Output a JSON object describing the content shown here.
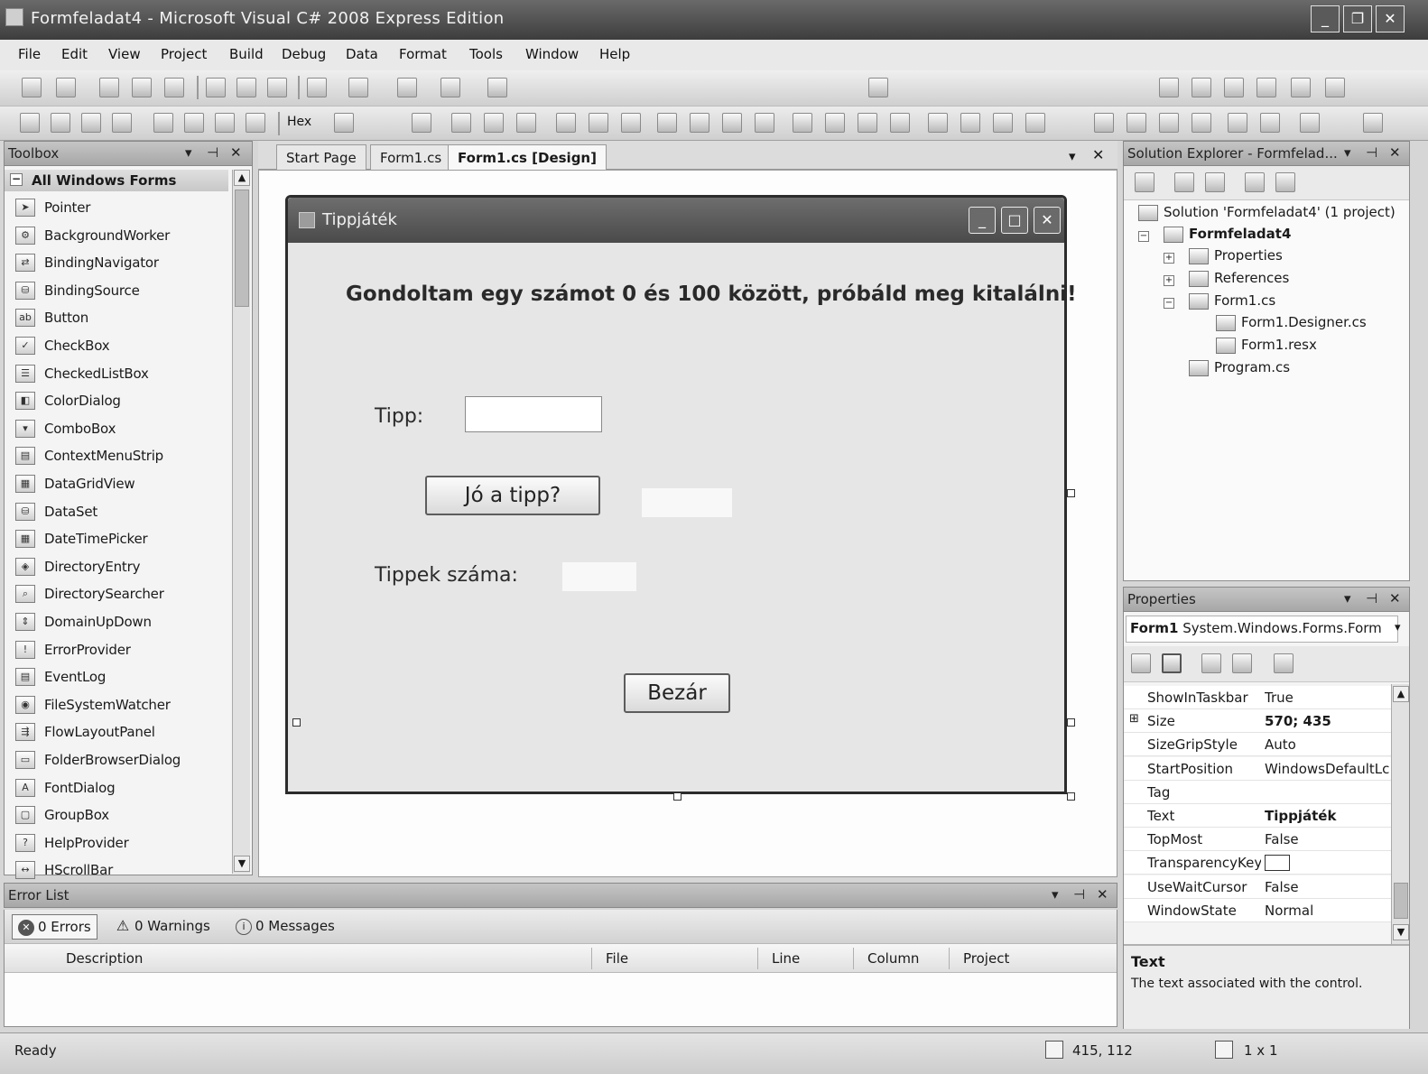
{
  "window": {
    "title": "Formfeladat4 - Microsoft Visual C# 2008 Express Edition",
    "minimize": "_",
    "restore": "❐",
    "close": "✕"
  },
  "menu": [
    "File",
    "Edit",
    "View",
    "Project",
    "Build",
    "Debug",
    "Data",
    "Format",
    "Tools",
    "Window",
    "Help"
  ],
  "toolbar": {
    "hex_label": "Hex"
  },
  "toolbox": {
    "title": "Toolbox",
    "group": "All Windows Forms",
    "items": [
      {
        "label": "Pointer",
        "icon": "pointer-icon",
        "glyph": "➤"
      },
      {
        "label": "BackgroundWorker",
        "icon": "background-worker-icon",
        "glyph": "⚙"
      },
      {
        "label": "BindingNavigator",
        "icon": "binding-navigator-icon",
        "glyph": "⇄"
      },
      {
        "label": "BindingSource",
        "icon": "binding-source-icon",
        "glyph": "⛁"
      },
      {
        "label": "Button",
        "icon": "button-icon",
        "glyph": "ab"
      },
      {
        "label": "CheckBox",
        "icon": "checkbox-icon",
        "glyph": "✓"
      },
      {
        "label": "CheckedListBox",
        "icon": "checked-listbox-icon",
        "glyph": "☰"
      },
      {
        "label": "ColorDialog",
        "icon": "color-dialog-icon",
        "glyph": "◧"
      },
      {
        "label": "ComboBox",
        "icon": "combobox-icon",
        "glyph": "▾"
      },
      {
        "label": "ContextMenuStrip",
        "icon": "context-menu-icon",
        "glyph": "▤"
      },
      {
        "label": "DataGridView",
        "icon": "data-grid-icon",
        "glyph": "▦"
      },
      {
        "label": "DataSet",
        "icon": "dataset-icon",
        "glyph": "⛁"
      },
      {
        "label": "DateTimePicker",
        "icon": "datetime-picker-icon",
        "glyph": "▦"
      },
      {
        "label": "DirectoryEntry",
        "icon": "directory-entry-icon",
        "glyph": "◈"
      },
      {
        "label": "DirectorySearcher",
        "icon": "directory-searcher-icon",
        "glyph": "⌕"
      },
      {
        "label": "DomainUpDown",
        "icon": "domain-updown-icon",
        "glyph": "⇕"
      },
      {
        "label": "ErrorProvider",
        "icon": "error-provider-icon",
        "glyph": "!"
      },
      {
        "label": "EventLog",
        "icon": "eventlog-icon",
        "glyph": "▤"
      },
      {
        "label": "FileSystemWatcher",
        "icon": "filesystem-watcher-icon",
        "glyph": "◉"
      },
      {
        "label": "FlowLayoutPanel",
        "icon": "flowlayout-panel-icon",
        "glyph": "⇶"
      },
      {
        "label": "FolderBrowserDialog",
        "icon": "folder-browser-icon",
        "glyph": "▭"
      },
      {
        "label": "FontDialog",
        "icon": "font-dialog-icon",
        "glyph": "A"
      },
      {
        "label": "GroupBox",
        "icon": "groupbox-icon",
        "glyph": "▢"
      },
      {
        "label": "HelpProvider",
        "icon": "help-provider-icon",
        "glyph": "?"
      },
      {
        "label": "HScrollBar",
        "icon": "hscrollbar-icon",
        "glyph": "↔"
      }
    ]
  },
  "doc_tabs": [
    {
      "label": "Start Page",
      "active": false
    },
    {
      "label": "Form1.cs",
      "active": false
    },
    {
      "label": "Form1.cs [Design]",
      "active": true
    }
  ],
  "form": {
    "title": "Tippjáték",
    "heading": "Gondoltam egy számot 0 és 100 között, próbáld meg kitalálni!",
    "tipp_label": "Tipp:",
    "check_button": "Jó a tipp?",
    "count_label": "Tippek száma:",
    "close_button": "Bezár"
  },
  "solution_explorer": {
    "title": "Solution Explorer - Formfelad...",
    "solution": "Solution 'Formfeladat4' (1 project)",
    "project": "Formfeladat4",
    "nodes": [
      "Properties",
      "References",
      "Form1.cs",
      "Form1.Designer.cs",
      "Form1.resx",
      "Program.cs"
    ]
  },
  "properties": {
    "title": "Properties",
    "object_name": "Form1",
    "object_type": "System.Windows.Forms.Form",
    "rows": [
      {
        "name": "ShowInTaskbar",
        "value": "True"
      },
      {
        "name": "Size",
        "value": "570; 435"
      },
      {
        "name": "SizeGripStyle",
        "value": "Auto"
      },
      {
        "name": "StartPosition",
        "value": "WindowsDefaultLc"
      },
      {
        "name": "Tag",
        "value": ""
      },
      {
        "name": "Text",
        "value": "Tippjáték"
      },
      {
        "name": "TopMost",
        "value": "False"
      },
      {
        "name": "TransparencyKey",
        "value": ""
      },
      {
        "name": "UseWaitCursor",
        "value": "False"
      },
      {
        "name": "WindowState",
        "value": "Normal"
      }
    ],
    "desc_title": "Text",
    "desc_text": "The text associated with the control."
  },
  "error_list": {
    "title": "Error List",
    "errors": "0 Errors",
    "warnings": "0 Warnings",
    "messages": "0 Messages",
    "columns": [
      "Description",
      "File",
      "Line",
      "Column",
      "Project"
    ]
  },
  "status": {
    "text": "Ready",
    "position": "415, 112",
    "size": "1 x 1"
  }
}
